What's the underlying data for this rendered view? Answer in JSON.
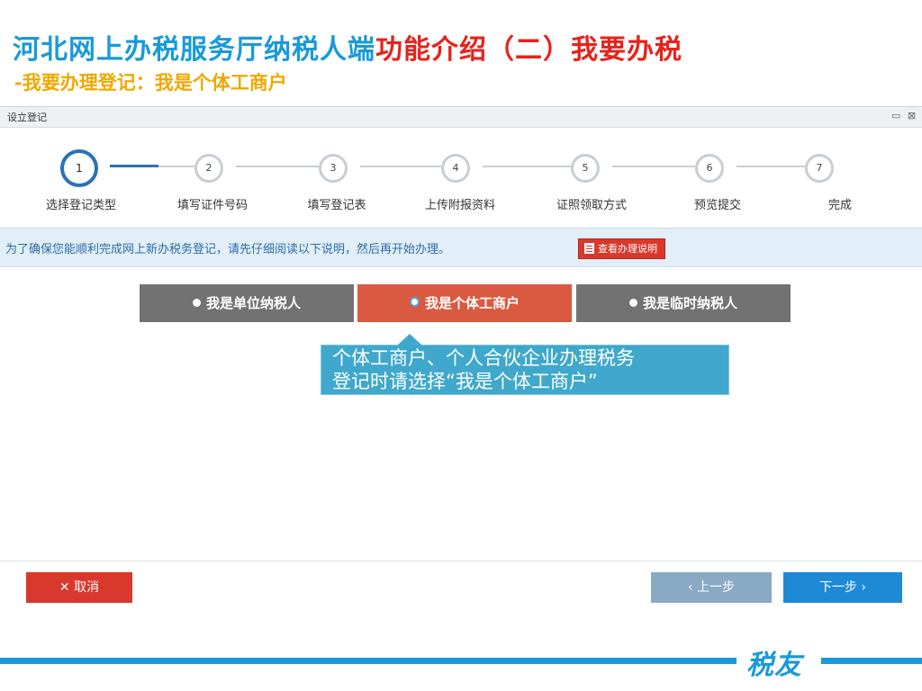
{
  "slide": {
    "title_part1": "河北网上办税服务厅纳税人端",
    "title_part2": "功能介绍（二）我要办税",
    "subtitle": "-我要办理登记：我是个体工商户",
    "brand": "税友"
  },
  "window": {
    "title": "设立登记",
    "controls": [
      "▭",
      "⊠"
    ]
  },
  "steps": [
    {
      "num": "1",
      "label": "选择登记类型",
      "active": true
    },
    {
      "num": "2",
      "label": "填写证件号码",
      "active": false
    },
    {
      "num": "3",
      "label": "填写登记表",
      "active": false
    },
    {
      "num": "4",
      "label": "上传附报资料",
      "active": false
    },
    {
      "num": "5",
      "label": "证照领取方式",
      "active": false
    },
    {
      "num": "6",
      "label": "预览提交",
      "active": false
    },
    {
      "num": "7",
      "label": "完成",
      "active": false
    }
  ],
  "info": {
    "text": "为了确保您能顺利完成网上新办税务登记，请先仔细阅读以下说明，然后再开始办理。",
    "guide_button": "查看办理说明"
  },
  "taxpayer_types": [
    {
      "label": "我是单位纳税人",
      "selected": false
    },
    {
      "label": "我是个体工商户",
      "selected": true
    },
    {
      "label": "我是临时纳税人",
      "selected": false
    }
  ],
  "tooltip": {
    "line1": "个体工商户、个人合伙企业办理税务",
    "line2": "登记时请选择“我是个体工商户”"
  },
  "footer": {
    "cancel": "✕ 取消",
    "prev": "‹ 上一步",
    "next": "下一步 ›"
  },
  "colors": {
    "primary_blue": "#1a9ad8",
    "title_red": "#e8221b",
    "subtitle_orange": "#f0a800",
    "selected_red": "#d95a41",
    "step_active": "#2b71b5"
  }
}
